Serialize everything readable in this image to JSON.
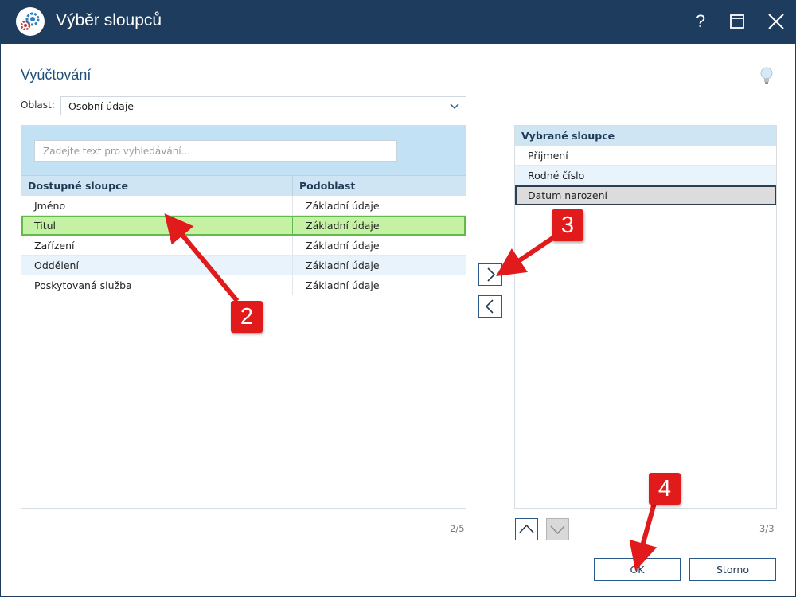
{
  "window": {
    "title": "Výběr sloupců",
    "help_glyph": "?"
  },
  "page": {
    "title": "Vyúčtování"
  },
  "area": {
    "label": "Oblast:",
    "value": "Osobní údaje"
  },
  "available": {
    "search_placeholder": "Zadejte text pro vyhledávání...",
    "columns": [
      "Dostupné sloupce",
      "Podoblast"
    ],
    "rows": [
      {
        "name": "Jméno",
        "sub": "Základní údaje"
      },
      {
        "name": "Titul",
        "sub": "Základní údaje"
      },
      {
        "name": "Zařízení",
        "sub": "Základní údaje"
      },
      {
        "name": "Oddělení",
        "sub": "Základní údaje"
      },
      {
        "name": "Poskytovaná služba",
        "sub": "Základní údaje"
      }
    ],
    "selected_index": 1,
    "count": "2/5"
  },
  "selected": {
    "header": "Vybrané sloupce",
    "rows": [
      "Příjmení",
      "Rodné číslo",
      "Datum narození"
    ],
    "selected_index": 2,
    "count": "3/3"
  },
  "buttons": {
    "ok": "OK",
    "cancel": "Storno"
  },
  "annotations": {
    "step2": "2",
    "step3": "3",
    "step4": "4"
  },
  "colors": {
    "titlebar": "#1e3c5e",
    "accent": "#1f4f78",
    "selection_green": "#c5f1a5",
    "annotation_red": "#e11b1b"
  }
}
